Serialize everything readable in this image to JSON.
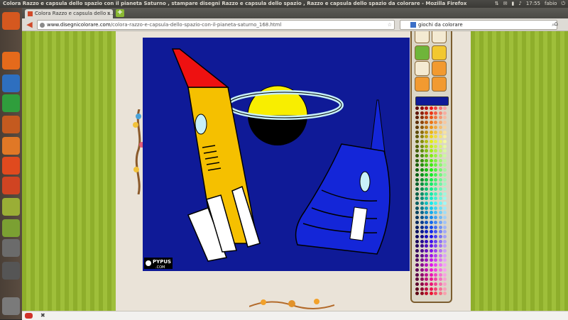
{
  "window": {
    "title": "Colora Razzo e capsula dello spazio con il pianeta Saturno , stampare disegni Razzo e capsula dello spazio , Razzo e capsula dello spazio da colorare - Mozilla Firefox",
    "clock": "17:55",
    "user": "fabio"
  },
  "tab": {
    "label": "Colora Razzo e capsula dello s...",
    "close": "×",
    "new_tab": "+"
  },
  "navbar": {
    "url_domain": "www.disegnicolorare.com",
    "url_path": "/colora-razzo-e-capsula-dello-spazio-con-il-pianeta-saturno_168.html",
    "search_value": "giochi da colorare"
  },
  "canvas": {
    "watermark": "PYPUS",
    "watermark_sub": ".COM",
    "background": "#0f1a97",
    "rocket_body": "#f5c000",
    "rocket_nose": "#ee1111",
    "planet": "#f8ee00",
    "capsule": "#1426d8"
  },
  "palette": {
    "current_color": "#0f1a97"
  },
  "statusbar": {
    "close": "✖"
  }
}
